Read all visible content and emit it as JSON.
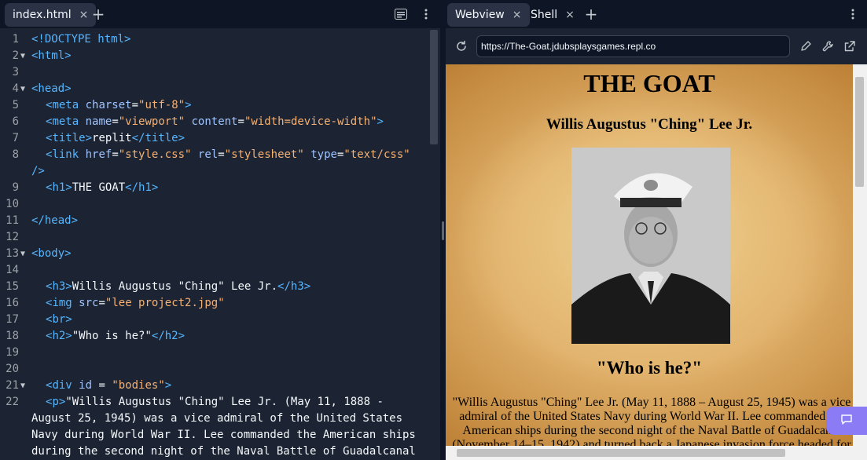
{
  "editor": {
    "tab": {
      "label": "index.html",
      "close": "×"
    },
    "add_tab": "+",
    "code_lines": [
      {
        "n": "1"
      },
      {
        "n": "2"
      },
      {
        "n": "3"
      },
      {
        "n": "4"
      },
      {
        "n": "5"
      },
      {
        "n": "6"
      },
      {
        "n": "7"
      },
      {
        "n": "8"
      },
      {
        "n": "9"
      },
      {
        "n": "10"
      },
      {
        "n": "11"
      },
      {
        "n": "12"
      },
      {
        "n": "13"
      },
      {
        "n": "14"
      },
      {
        "n": "15"
      },
      {
        "n": "16"
      },
      {
        "n": "17"
      },
      {
        "n": "18"
      },
      {
        "n": "19"
      },
      {
        "n": "20"
      },
      {
        "n": "21"
      },
      {
        "n": "22"
      }
    ],
    "code": {
      "l1": "<!DOCTYPE html>",
      "l2": "<html>",
      "l4": "<head>",
      "l5_tag": "meta",
      "l5_attr1": "charset",
      "l5_val1": "\"utf-8\"",
      "l6_tag": "meta",
      "l6_attr1": "name",
      "l6_val1": "\"viewport\"",
      "l6_attr2": "content",
      "l6_val2": "\"width=device-width\"",
      "l7_tag": "title",
      "l7_text": "replit",
      "l8_tag": "link",
      "l8_attr1": "href",
      "l8_val1": "\"style.css\"",
      "l8_attr2": "rel",
      "l8_val2": "\"stylesheet\"",
      "l8_attr3": "type",
      "l8_val3": "\"text/css\"",
      "l8_wrap": "/>",
      "l9_tag": "h1",
      "l9_text": "THE GOAT",
      "l11": "</head>",
      "l13": "<body>",
      "l15_tag": "h3",
      "l15_text": "Willis Augustus \"Ching\" Lee Jr.",
      "l16_tag": "img",
      "l16_attr1": "src",
      "l16_val1": "\"lee project2.jpg\"",
      "l17_tag": "br",
      "l18_tag": "h2",
      "l18_text": "\"Who is he?\"",
      "l21_tag": "div",
      "l21_attr1": "id",
      "l21_eq": " = ",
      "l21_val1": "\"bodies\"",
      "l22_tag": "p",
      "l22_text": "\"Willis Augustus \"Ching\" Lee Jr. (May 11, 1888 -",
      "l22_w1": "August 25, 1945) was a vice admiral of the United States",
      "l22_w2": "Navy during World War II. Lee commanded the American ships",
      "l22_w3": "during the second night of the Naval Battle of Guadalcanal"
    }
  },
  "preview": {
    "tabs": [
      {
        "label": "Webview",
        "close": "×"
      },
      {
        "label": "Shell",
        "close": "×"
      }
    ],
    "add_tab": "+",
    "url": "https://The-Goat.jdubsplaysgames.repl.co",
    "page": {
      "h1": "THE GOAT",
      "h3": "Willis Augustus \"Ching\" Lee Jr.",
      "h2": "\"Who is he?\"",
      "paragraph": "\"Willis Augustus \"Ching\" Lee Jr. (May 11, 1888 – August 25, 1945) was a vice admiral of the United States Navy during World War II. Lee commanded the American ships during the second night of the Naval Battle of Guadalcanal (November 14–15, 1942) and turned back a Japanese invasion force headed for"
    }
  },
  "colors": {
    "bg": "#0e1525",
    "panel": "#1c2333",
    "tag": "#56b6ff",
    "attr": "#9fc4ff",
    "string": "#f4b274",
    "accent": "#8b7cf6"
  }
}
